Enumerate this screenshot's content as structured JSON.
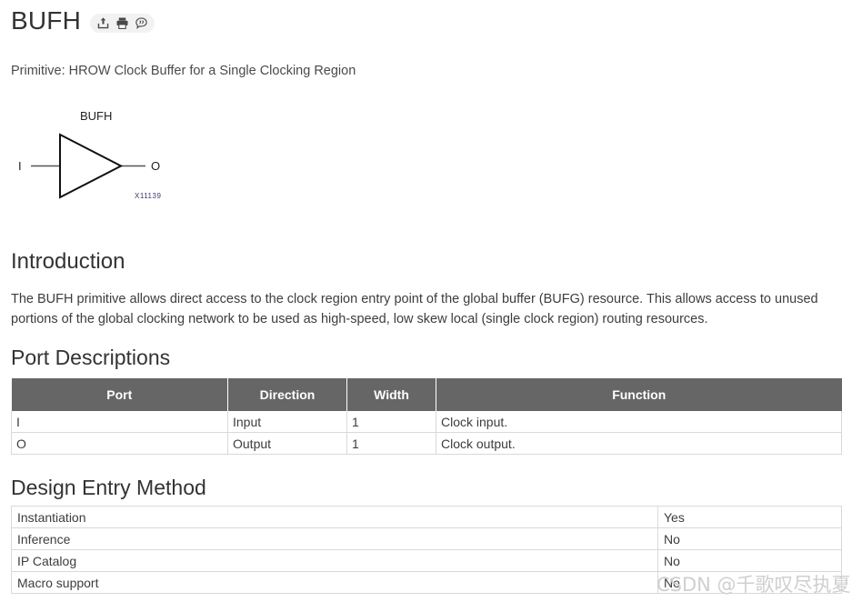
{
  "header": {
    "title": "BUFH",
    "actions": [
      {
        "name": "share-icon",
        "label": "Share"
      },
      {
        "name": "print-icon",
        "label": "Print"
      },
      {
        "name": "feedback-icon",
        "label": "Feedback"
      }
    ]
  },
  "subtitle": "Primitive: HROW Clock Buffer for a Single Clocking Region",
  "figure": {
    "symbol_label": "BUFH",
    "input_pin": "I",
    "output_pin": "O",
    "figure_id": "X11139"
  },
  "sections": {
    "introduction": {
      "heading": "Introduction",
      "paragraph": "The BUFH primitive allows direct access to the clock region entry point of the global buffer (BUFG) resource. This allows access to unused portions of the global clocking network to be used as high-speed, low skew local (single clock region) routing resources."
    },
    "port_descriptions": {
      "heading": "Port Descriptions",
      "columns": [
        "Port",
        "Direction",
        "Width",
        "Function"
      ],
      "rows": [
        [
          "I",
          "Input",
          "1",
          "Clock input."
        ],
        [
          "O",
          "Output",
          "1",
          "Clock output."
        ]
      ]
    },
    "design_entry_method": {
      "heading": "Design Entry Method",
      "rows": [
        [
          "Instantiation",
          "Yes"
        ],
        [
          "Inference",
          "No"
        ],
        [
          "IP Catalog",
          "No"
        ],
        [
          "Macro support",
          "No"
        ]
      ]
    }
  },
  "watermark": "CSDN @千歌叹尽执夏",
  "colors": {
    "table_header_bg": "#666666",
    "table_border": "#d9d9d9",
    "text": "#333333",
    "watermark": "#cfcfcf"
  }
}
